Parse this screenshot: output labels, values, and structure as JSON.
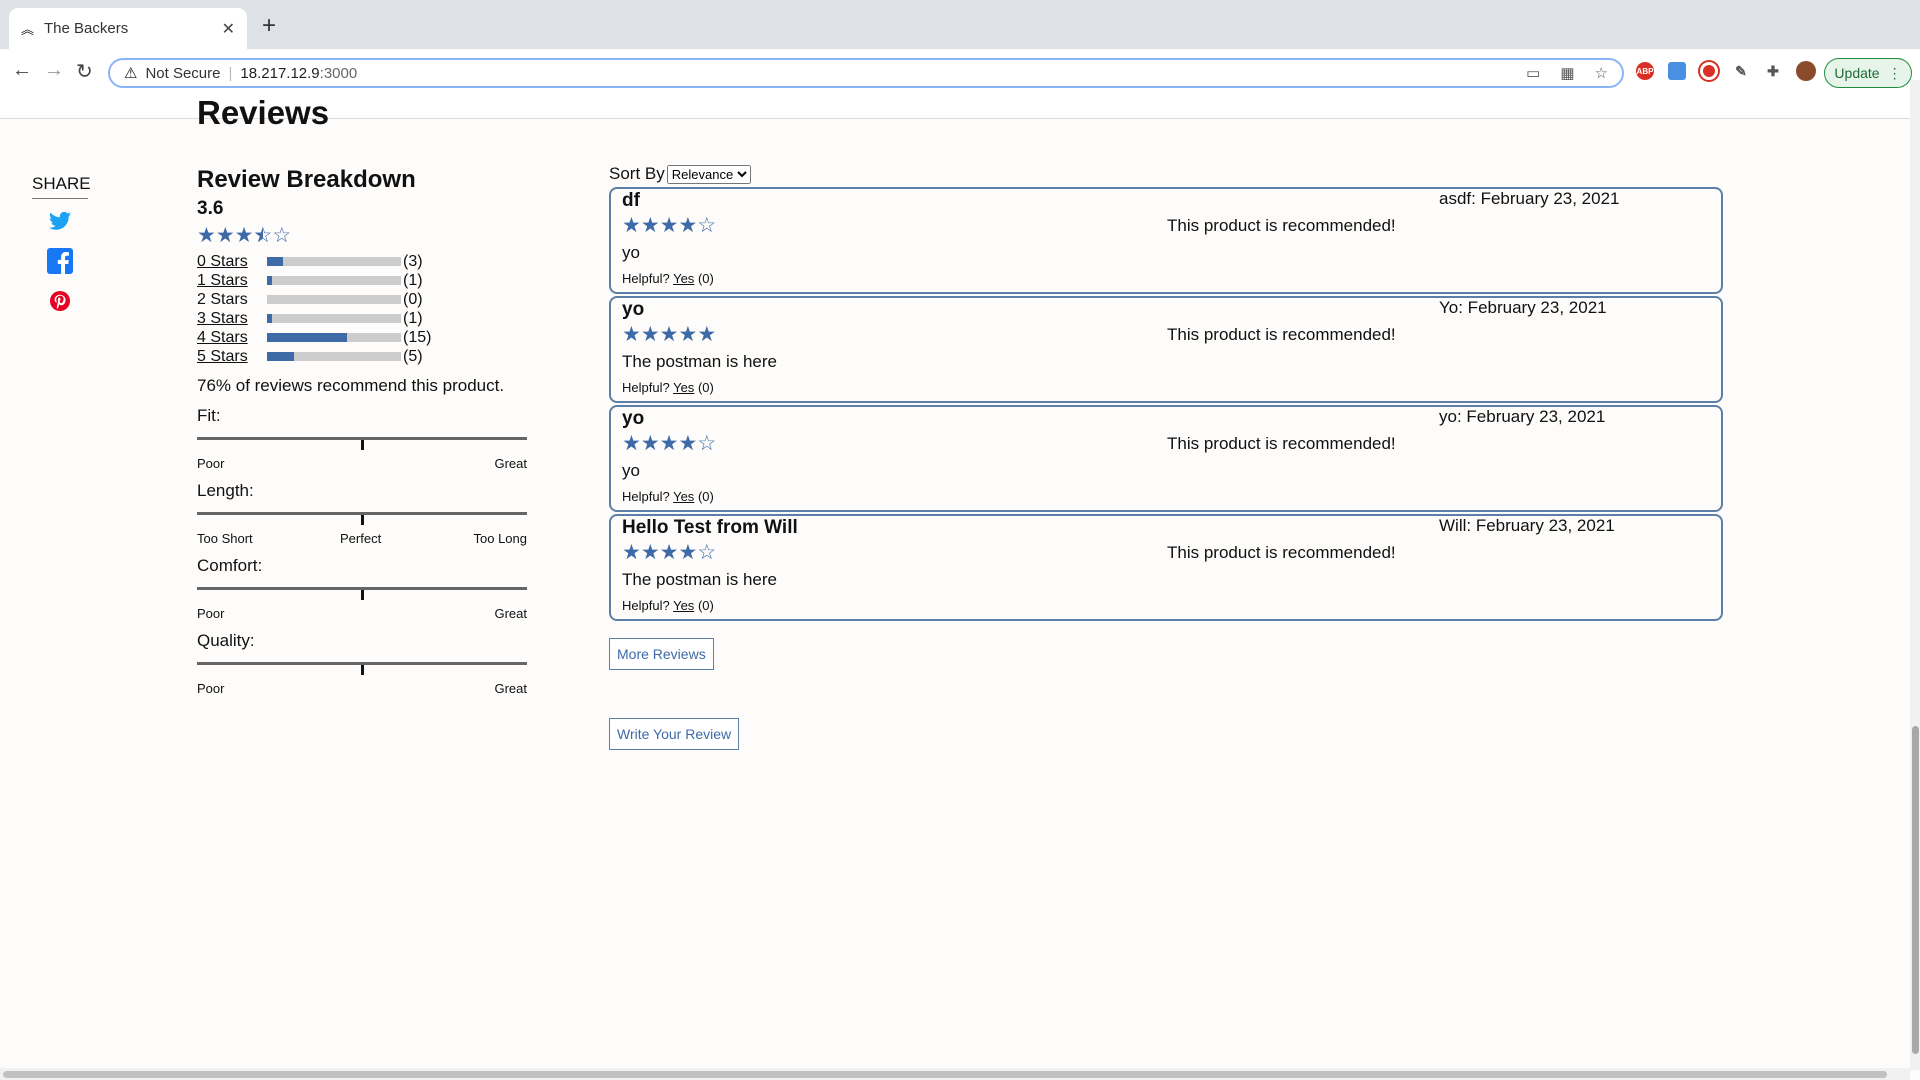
{
  "browser": {
    "tab_title": "The Backers",
    "not_secure": "Not Secure",
    "url_host": "18.217.12.9",
    "url_port": ":3000",
    "update_label": "Update"
  },
  "page": {
    "heading": "Reviews",
    "share_label": "SHARE",
    "share_icons": [
      "twitter-icon",
      "facebook-icon",
      "pinterest-icon"
    ]
  },
  "breakdown": {
    "title": "Review Breakdown",
    "average": "3.6",
    "average_stars": 3.5,
    "rows": [
      {
        "label": "0 Stars",
        "count": "(3)",
        "fraction": 0.12,
        "linked": true
      },
      {
        "label": "1 Stars",
        "count": "(1)",
        "fraction": 0.04,
        "linked": true
      },
      {
        "label": "2 Stars",
        "count": "(0)",
        "fraction": 0,
        "linked": false
      },
      {
        "label": "3 Stars",
        "count": "(1)",
        "fraction": 0.04,
        "linked": true
      },
      {
        "label": "4 Stars",
        "count": "(15)",
        "fraction": 0.6,
        "linked": true
      },
      {
        "label": "5 Stars",
        "count": "(5)",
        "fraction": 0.2,
        "linked": true
      }
    ],
    "recommend_text": "76% of reviews recommend this product.",
    "characteristics": [
      {
        "name": "Fit:",
        "low": "Poor",
        "mid": "",
        "high": "Great",
        "value": 0.5
      },
      {
        "name": "Length:",
        "low": "Too Short",
        "mid": "Perfect",
        "high": "Too Long",
        "value": 0.5
      },
      {
        "name": "Comfort:",
        "low": "Poor",
        "mid": "",
        "high": "Great",
        "value": 0.5
      },
      {
        "name": "Quality:",
        "low": "Poor",
        "mid": "",
        "high": "Great",
        "value": 0.5
      }
    ]
  },
  "sort": {
    "label": "Sort By",
    "selected": "Relevance"
  },
  "reviews": [
    {
      "title": "df",
      "rating": 4,
      "body": "yo",
      "recommend": "This product is recommended!",
      "date": "asdf: February 23, 2021",
      "helpful_label": "Helpful?",
      "yes_label": "Yes",
      "helpful_count": "(0)"
    },
    {
      "title": "yo",
      "rating": 5,
      "body": "The postman is here",
      "recommend": "This product is recommended!",
      "date": "Yo: February 23, 2021",
      "helpful_label": "Helpful?",
      "yes_label": "Yes",
      "helpful_count": "(0)"
    },
    {
      "title": "yo",
      "rating": 4,
      "body": "yo",
      "recommend": "This product is recommended!",
      "date": "yo: February 23, 2021",
      "helpful_label": "Helpful?",
      "yes_label": "Yes",
      "helpful_count": "(0)"
    },
    {
      "title": "Hello Test from Will",
      "rating": 4,
      "body": "The postman is here",
      "recommend": "This product is recommended!",
      "date": "Will: February 23, 2021",
      "helpful_label": "Helpful?",
      "yes_label": "Yes",
      "helpful_count": "(0)"
    }
  ],
  "buttons": {
    "more_reviews": "More Reviews",
    "write_review": "Write Your Review"
  },
  "colors": {
    "star": "#3e6aa8",
    "card_border": "#5b7fa6"
  }
}
